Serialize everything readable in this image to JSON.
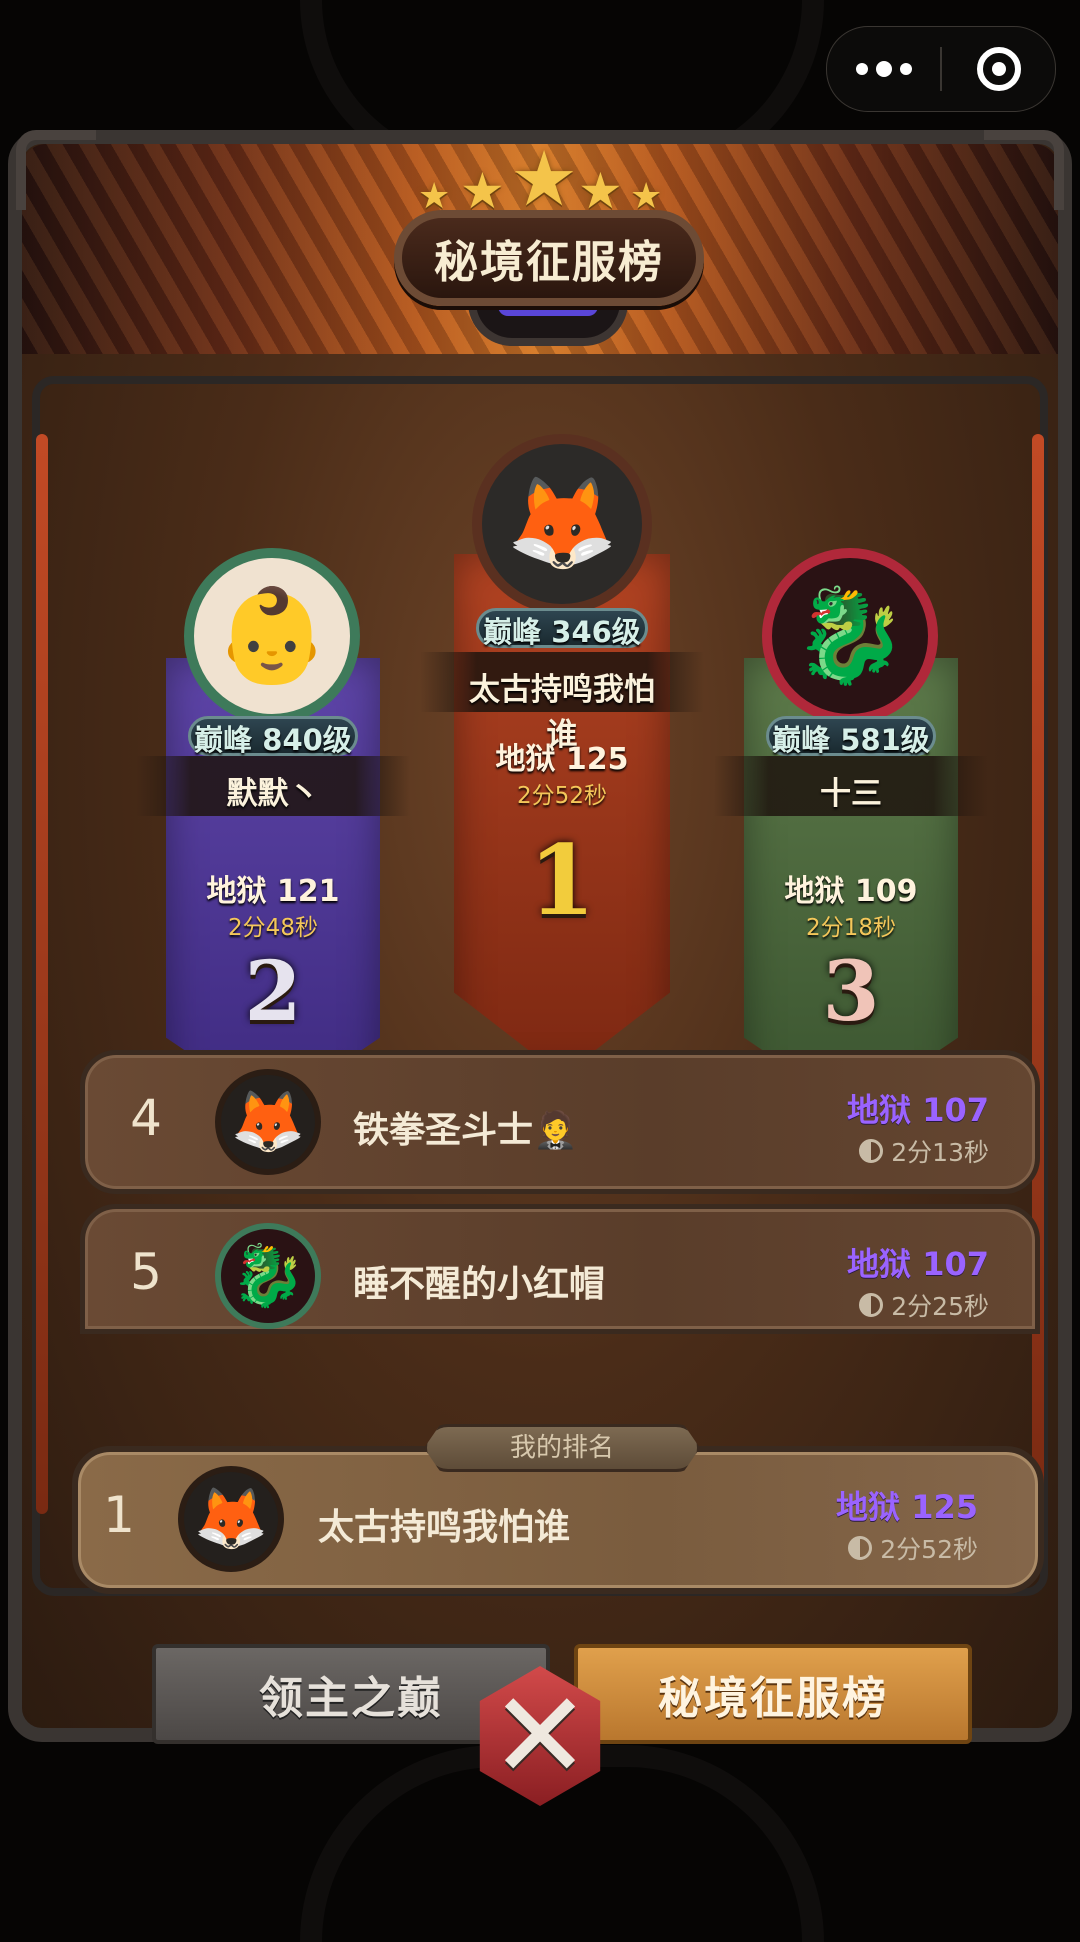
{
  "capsule": {
    "more_icon": "more-dots-icon",
    "close_icon": "target-close-icon"
  },
  "header": {
    "title": "秘境征服榜",
    "stars": 5
  },
  "podium": [
    {
      "rank": "2",
      "level": "巅峰 840级",
      "name": "默默丶",
      "mode": "地狱 121",
      "time": "2分48秒",
      "color": "#4a3390"
    },
    {
      "rank": "1",
      "level": "巅峰 346级",
      "name": "太古持鸣我怕谁",
      "mode": "地狱 125",
      "time": "2分52秒",
      "color": "#a3371a"
    },
    {
      "rank": "3",
      "level": "巅峰 581级",
      "name": "十三",
      "mode": "地狱 109",
      "time": "2分18秒",
      "color": "#4a6538"
    }
  ],
  "rows": [
    {
      "rank": "4",
      "name": "铁拳圣斗士🤵",
      "mode": "地狱 107",
      "time": "2分13秒"
    },
    {
      "rank": "5",
      "name": "睡不醒的小红帽",
      "mode": "地狱 107",
      "time": "2分25秒"
    }
  ],
  "my_rank": {
    "label": "我的排名",
    "rank": "1",
    "name": "太古持鸣我怕谁",
    "mode": "地狱 125",
    "time": "2分52秒"
  },
  "tabs": {
    "lord": "领主之巅",
    "secret": "秘境征服榜"
  },
  "close": {
    "symbol": "✕"
  },
  "colors": {
    "mode_purple": "#9a63ff",
    "gold": "#f4c75a",
    "tab_active": "#d6963f"
  }
}
